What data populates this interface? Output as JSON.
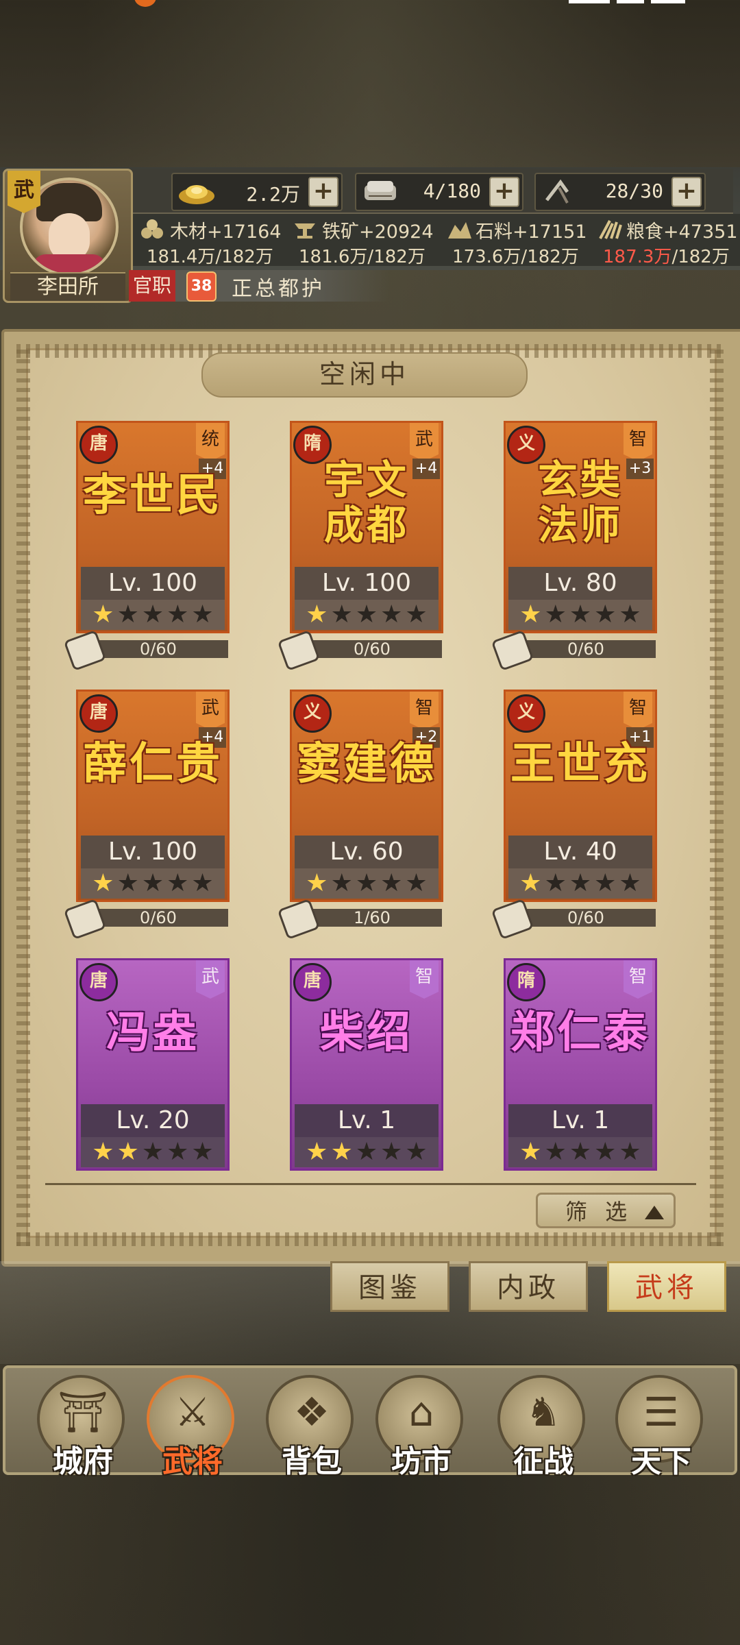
{
  "player": {
    "badge": "武",
    "name": "李田所"
  },
  "resources": {
    "gold": {
      "value": "2.2万",
      "icon": "gold-ingot-icon"
    },
    "scroll": {
      "value": "4/180",
      "icon": "scroll-stack-icon"
    },
    "stamina": {
      "value": "28/30",
      "icon": "pickaxe-icon"
    }
  },
  "materials": [
    {
      "name": "木材+17164",
      "cap": "181.4万/182万",
      "over": false,
      "icon": "wood-icon"
    },
    {
      "name": "铁矿+20924",
      "cap": "181.6万/182万",
      "over": false,
      "icon": "anvil-icon"
    },
    {
      "name": "石料+17151",
      "cap": "173.6万/182万",
      "over": false,
      "icon": "stone-icon"
    },
    {
      "name": "粮食+47351",
      "cap_over": "187.3万",
      "cap_rest": "/182万",
      "over": true,
      "icon": "grain-icon"
    }
  ],
  "office": {
    "label": "官职",
    "level": "38",
    "title": "正总都护"
  },
  "panel": {
    "title": "空闲中"
  },
  "generals": [
    {
      "dynasty": "唐",
      "type": "统",
      "bonus": "+4",
      "name": "李世民",
      "level": "Lv. 100",
      "stars": 1,
      "fragments": "0/60",
      "rarity": "orange"
    },
    {
      "dynasty": "隋",
      "type": "武",
      "bonus": "+4",
      "name_line1": "宇文",
      "name_line2": "成都",
      "level": "Lv. 100",
      "stars": 1,
      "fragments": "0/60",
      "rarity": "orange"
    },
    {
      "dynasty": "义",
      "type": "智",
      "bonus": "+3",
      "name_line1": "玄奘",
      "name_line2": "法师",
      "level": "Lv. 80",
      "stars": 1,
      "fragments": "0/60",
      "rarity": "orange"
    },
    {
      "dynasty": "唐",
      "type": "武",
      "bonus": "+4",
      "name": "薛仁贵",
      "level": "Lv. 100",
      "stars": 1,
      "fragments": "0/60",
      "rarity": "orange"
    },
    {
      "dynasty": "义",
      "type": "智",
      "bonus": "+2",
      "name": "窦建德",
      "level": "Lv. 60",
      "stars": 1,
      "fragments": "1/60",
      "rarity": "orange"
    },
    {
      "dynasty": "义",
      "type": "智",
      "bonus": "+1",
      "name": "王世充",
      "level": "Lv. 40",
      "stars": 1,
      "fragments": "0/60",
      "rarity": "orange"
    },
    {
      "dynasty": "唐",
      "type": "武",
      "bonus": "",
      "name": "冯盎",
      "level": "Lv. 20",
      "stars": 2,
      "fragments": "",
      "rarity": "purple"
    },
    {
      "dynasty": "唐",
      "type": "智",
      "bonus": "",
      "name": "柴绍",
      "level": "Lv. 1",
      "stars": 2,
      "fragments": "",
      "rarity": "purple"
    },
    {
      "dynasty": "隋",
      "type": "智",
      "bonus": "",
      "name": "郑仁泰",
      "level": "Lv. 1",
      "stars": 1,
      "fragments": "",
      "rarity": "purple"
    }
  ],
  "filter": {
    "label": "筛 选"
  },
  "tabs": [
    {
      "label": "图鉴",
      "active": false
    },
    {
      "label": "内政",
      "active": false
    },
    {
      "label": "武将",
      "active": true
    }
  ],
  "nav": [
    {
      "label": "城府",
      "icon": "city-gate-icon",
      "active": false
    },
    {
      "label": "武将",
      "icon": "warrior-icon",
      "active": true
    },
    {
      "label": "背包",
      "icon": "bag-icon",
      "active": false
    },
    {
      "label": "坊市",
      "icon": "market-stall-icon",
      "active": false
    },
    {
      "label": "征战",
      "icon": "battle-icon",
      "active": false
    },
    {
      "label": "天下",
      "icon": "world-scroll-icon",
      "active": false
    }
  ],
  "colors": {
    "orange_card": "#c26426",
    "purple_card": "#9a4aa6",
    "name_gold": "#ffd640",
    "name_pink": "#ff7ee8",
    "over_cap_red": "#ff5a4a",
    "active_tab_text": "#c53b1a"
  }
}
